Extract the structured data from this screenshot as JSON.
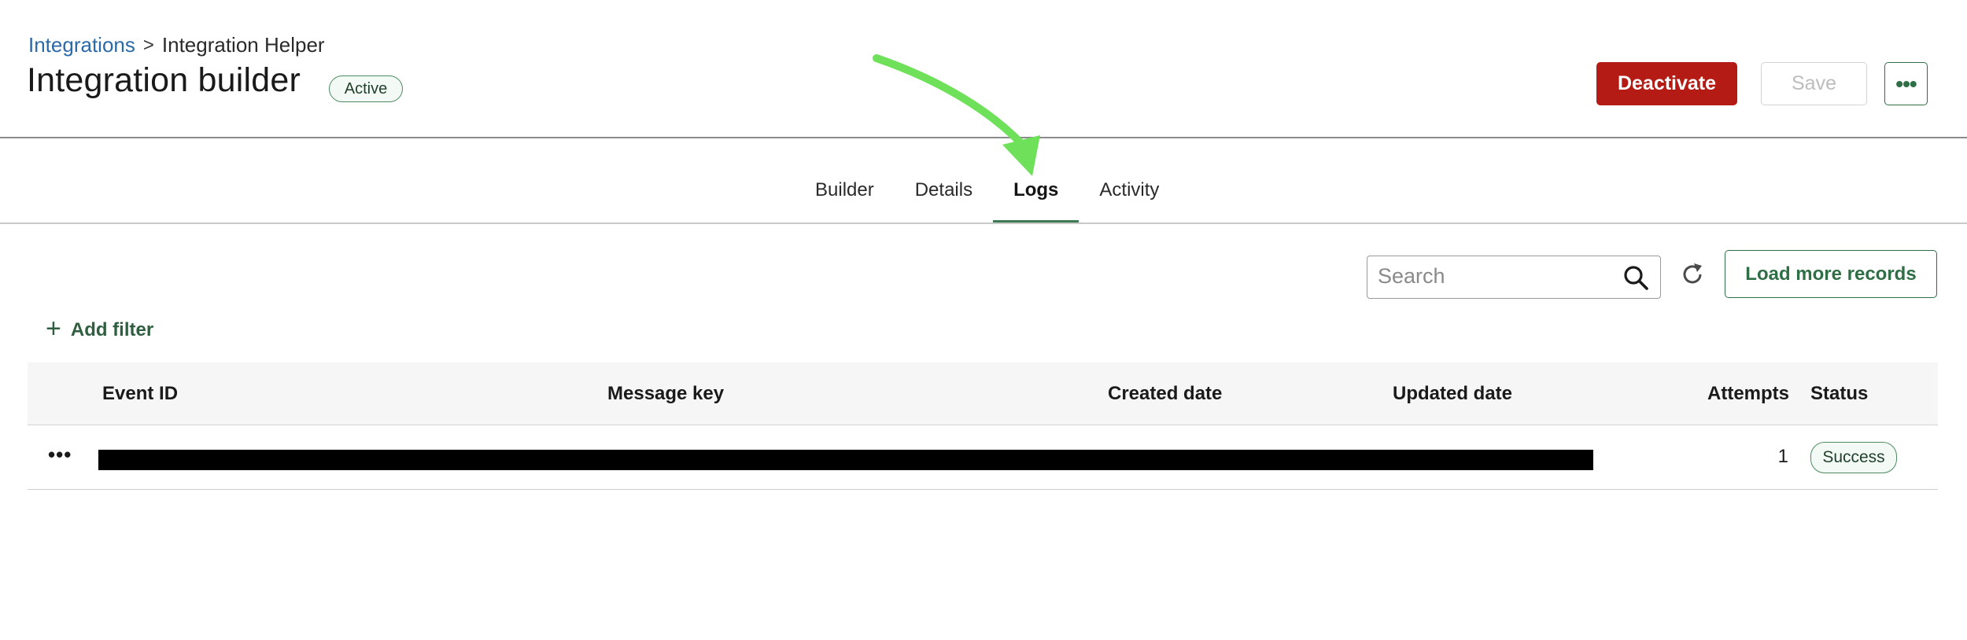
{
  "breadcrumb": {
    "parent": "Integrations",
    "separator": ">",
    "current": "Integration Helper"
  },
  "header": {
    "title": "Integration builder",
    "status": "Active",
    "deactivate_label": "Deactivate",
    "save_label": "Save",
    "more_label": "•••"
  },
  "tabs": [
    {
      "label": "Builder",
      "active": false
    },
    {
      "label": "Details",
      "active": false
    },
    {
      "label": "Logs",
      "active": true
    },
    {
      "label": "Activity",
      "active": false
    }
  ],
  "toolbar": {
    "search_placeholder": "Search",
    "load_more_label": "Load more records",
    "add_filter_label": "Add filter"
  },
  "table": {
    "columns": {
      "event_id": "Event ID",
      "message_key": "Message key",
      "created_date": "Created date",
      "updated_date": "Updated date",
      "attempts": "Attempts",
      "status": "Status"
    },
    "rows": [
      {
        "menu": "•••",
        "attempts": "1",
        "status": "Success"
      }
    ]
  },
  "colors": {
    "brand_green": "#2f6f45",
    "danger_red": "#b31b14",
    "link_blue": "#2b6aa8",
    "annotation_arrow": "#6ee05a"
  }
}
